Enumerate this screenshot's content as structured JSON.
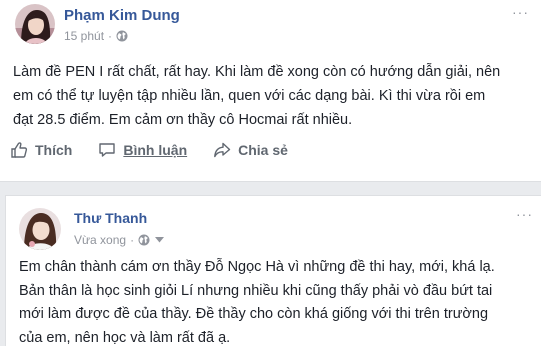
{
  "posts": [
    {
      "author": "Phạm Kim Dung",
      "time": "15 phút",
      "privacy_icon": "globe-icon",
      "lines": [
        "Làm đề PEN I rất chất, rất hay. Khi làm đề xong còn có hướng dẫn giải, nên",
        "em có thể tự luyện tập nhiều lần, quen với các dạng bài. Kì thi vừa rồi em",
        "đạt 28.5 điểm. Em cảm ơn thầy cô Hocmai rất nhiều."
      ],
      "actions": {
        "like": "Thích",
        "comment": "Bình luận",
        "share": "Chia sẻ"
      },
      "more": "···"
    },
    {
      "author": "Thư Thanh",
      "time": "Vừa xong",
      "privacy_icon": "globe-icon",
      "lines": [
        "Em chân thành cám ơn thầy Đỗ Ngọc Hà vì những đề thi hay, mới, khá lạ.",
        "Bản thân là học sinh giỏi Lí nhưng nhiều khi cũng thấy phải vò đầu bứt tai",
        "mới làm được đề của thầy. Đề thầy cho còn khá giống với thi trên trường",
        "của em, nên học và làm rất đã ạ."
      ],
      "more": "···"
    }
  ],
  "colors": {
    "name": "#365899",
    "meta": "#90949c",
    "text": "#1d2129",
    "action": "#606770",
    "background": "#e9ebee"
  }
}
